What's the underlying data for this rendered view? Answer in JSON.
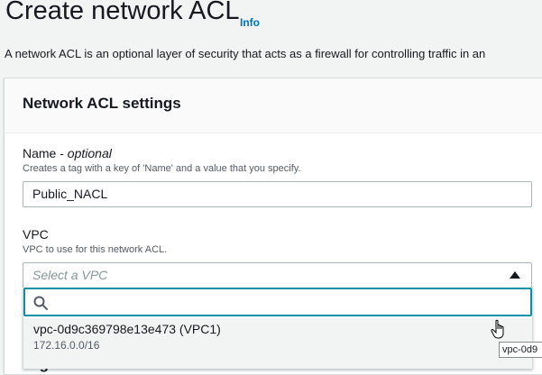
{
  "page": {
    "title": "Create network ACL",
    "info_label": "Info",
    "intro": "A network ACL is an optional layer of security that acts as a firewall for controlling traffic in an"
  },
  "settings": {
    "title": "Network ACL settings",
    "name_label": "Name - ",
    "name_optional": "optional",
    "name_description": "Creates a tag with a key of 'Name' and a value that you specify.",
    "name_value": "Public_NACL",
    "vpc_label": "VPC",
    "vpc_description": "VPC to use for this network ACL.",
    "vpc_placeholder": "Select a VPC"
  },
  "dropdown": {
    "options": [
      {
        "label": "vpc-0d9c369798e13e473 (VPC1)",
        "cidr": "172.16.0.0/16"
      }
    ]
  },
  "tooltip": "vpc-0d9",
  "next_section_partial": "Tag",
  "colors": {
    "link": "#0073bb",
    "focus_border": "#0a8fa6",
    "background": "#f2f3f3"
  }
}
